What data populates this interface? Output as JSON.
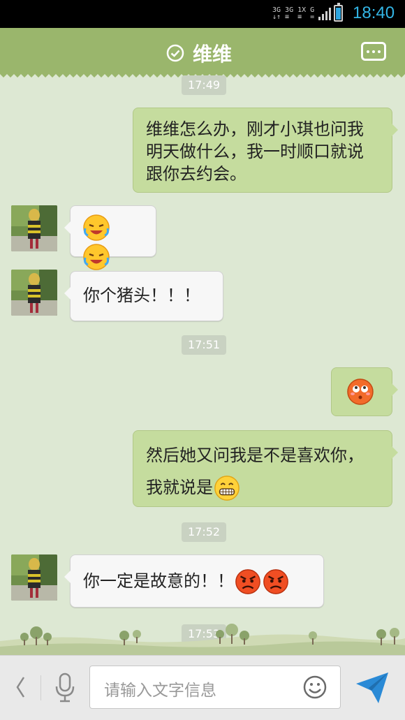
{
  "status": {
    "net1": "3G",
    "net2": "3G",
    "net3": "1X",
    "net4": "G",
    "time": "18:40"
  },
  "header": {
    "title": "维维"
  },
  "messages": {
    "t1": "17:49",
    "m1": "维维怎么办，刚才小琪也问我明天做什么，我一时顺口就说跟你去约会。",
    "m2_emoji": "laughing-tears-emoji",
    "m3": "你个猪头！！！",
    "t2": "17:51",
    "m4_emoji": "blushing-emoji",
    "m5_text": "然后她又问我是不是喜欢你，我就说是",
    "t3": "17:52",
    "m6_text": "你一定是故意的！！",
    "t4": "17:53"
  },
  "input": {
    "placeholder": "请输入文字信息"
  },
  "colors": {
    "header": "#9ab66c",
    "bubble_right": "#c5dc9e",
    "bubble_left": "#f7f7f7",
    "background": "#dde8d3"
  }
}
